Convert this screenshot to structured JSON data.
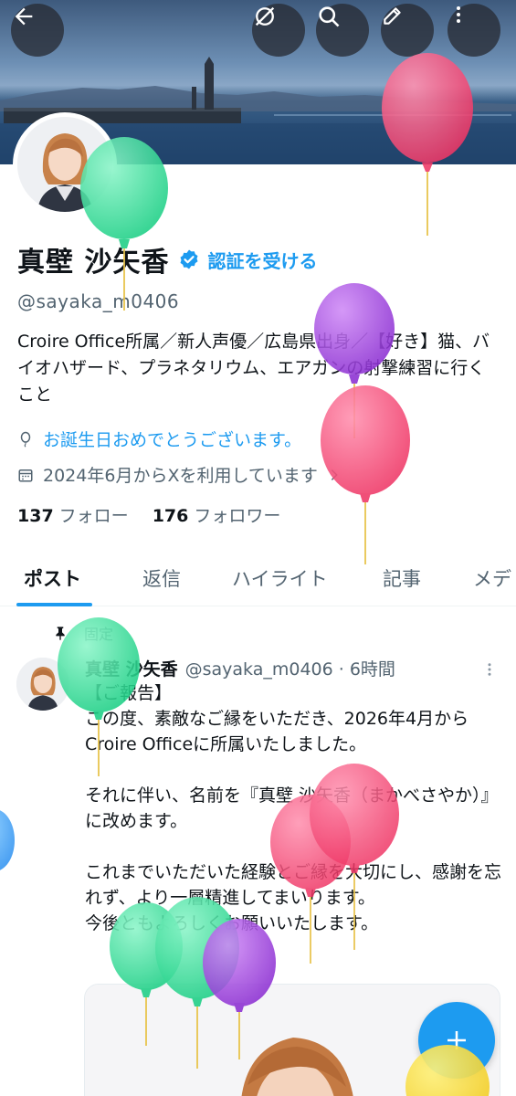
{
  "header": {
    "back_icon": "arrow-left-icon",
    "actions": [
      "hide-icon",
      "search-icon",
      "edit-icon",
      "more-vertical-icon"
    ]
  },
  "profile": {
    "display_name": "真壁 沙矢香",
    "verify_label": "認証を受ける",
    "handle": "@sayaka_m0406",
    "bio": "Croire Office所属／新人声優／広島県出身／【好き】猫、バイオハザード、プラネタリウム、エアガンの射撃練習に行くこと",
    "birthday": "お誕生日おめでとうございます。",
    "joined": "2024年6月からXを利用しています",
    "following_count": "137",
    "following_label": "フォロー",
    "followers_count": "176",
    "followers_label": "フォロワー"
  },
  "tabs": [
    {
      "label": "ポスト",
      "active": true
    },
    {
      "label": "返信",
      "active": false
    },
    {
      "label": "ハイライト",
      "active": false
    },
    {
      "label": "記事",
      "active": false
    },
    {
      "label": "メデ",
      "active": false
    }
  ],
  "post": {
    "pinned_label": "固定",
    "author_name": "真壁 沙矢香",
    "meta": "@sayaka_m0406 · 6時間",
    "lines": [
      "【ご報告】",
      "この度、素敵なご縁をいただき、2026年4月からCroire Officeに所属いたしました。",
      "",
      "それに伴い、名前を『真壁 沙矢香（まかべさやか）』に改めます。",
      "",
      "これまでいただいた経験とご縁を大切にし、感謝を忘れず、より一層精進してまいります。",
      "今後ともよろしくお願いいたします。"
    ]
  },
  "fab": {
    "icon": "plus-icon"
  },
  "colors": {
    "accent": "#1d9bf0",
    "text": "#0f1419",
    "muted": "#536471",
    "balloon_green": "#3ee0a0",
    "balloon_pink": "#f54d7b",
    "balloon_purple": "#a34be0",
    "balloon_yellow": "#f7d84a"
  }
}
